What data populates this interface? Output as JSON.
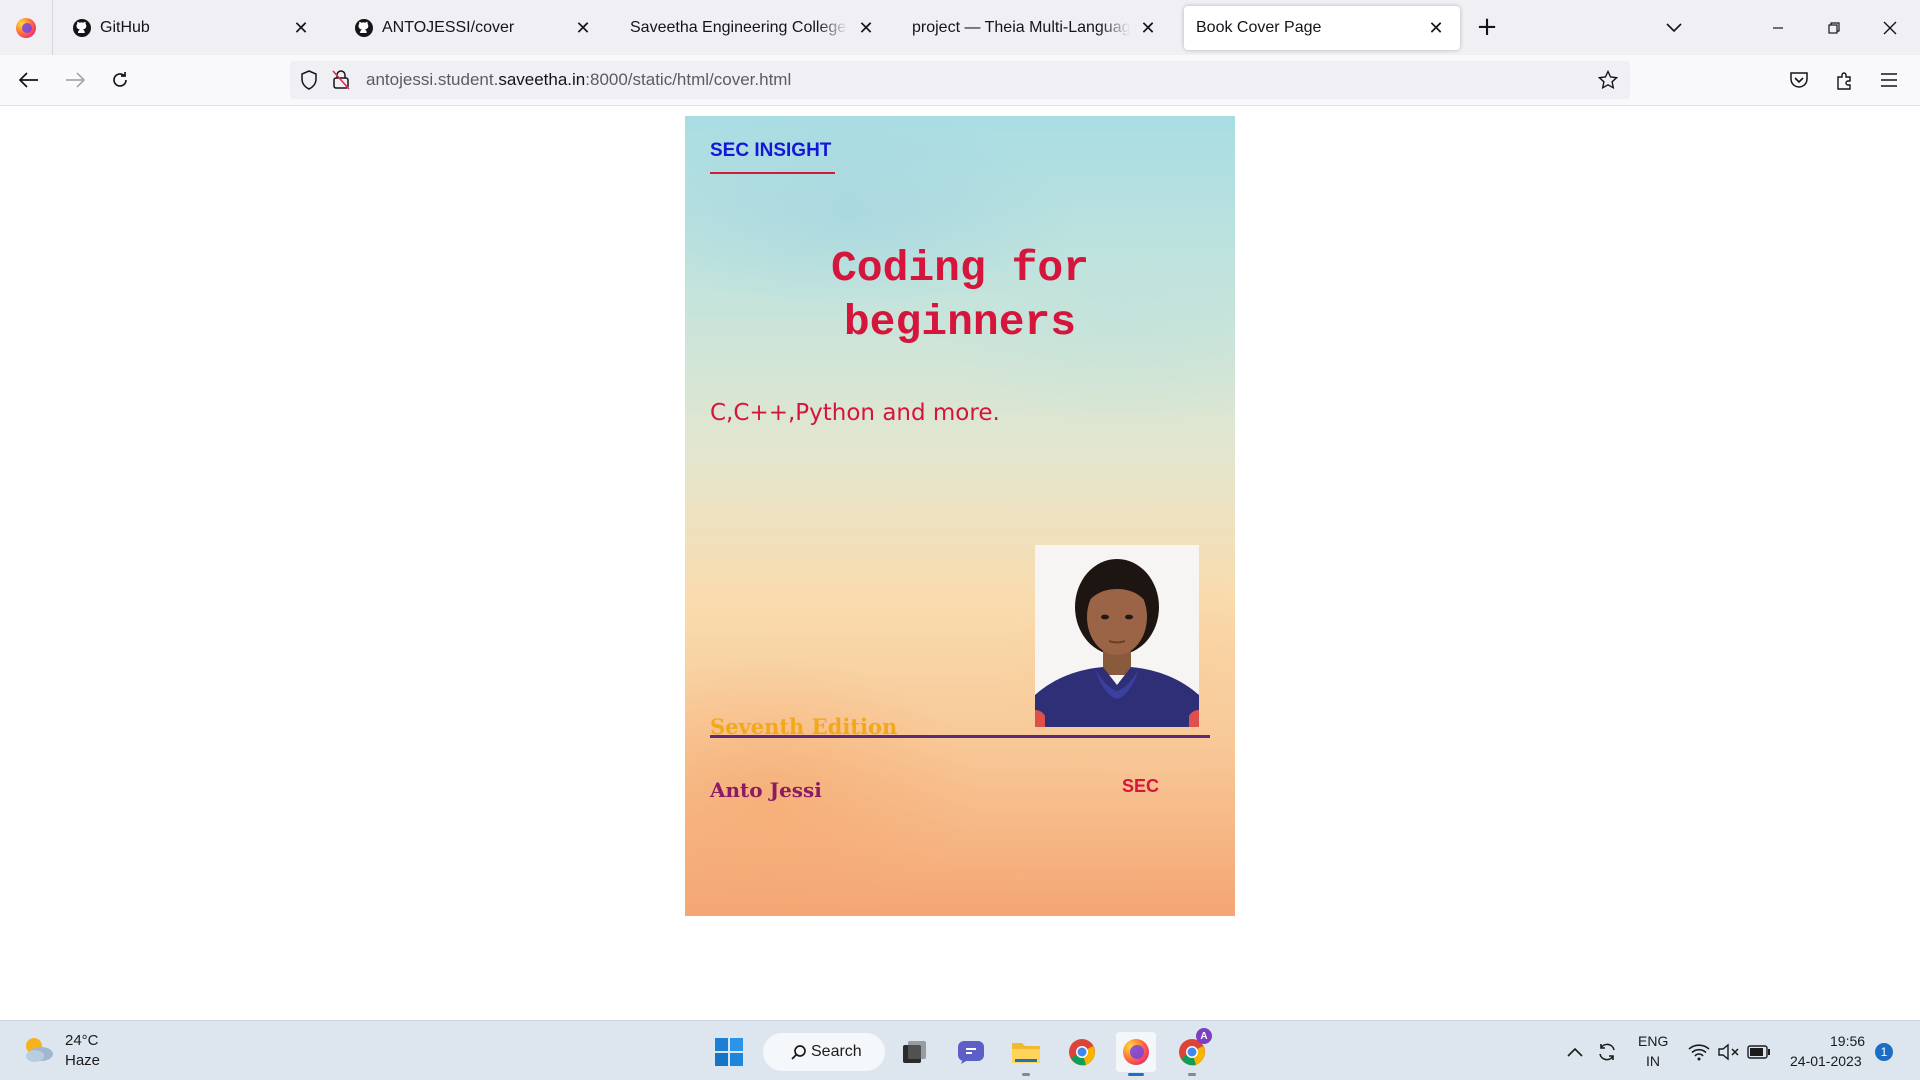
{
  "browser": {
    "tabs": [
      {
        "title": "GitHub",
        "icon": "github-icon",
        "active": false
      },
      {
        "title": "ANTOJESSI/cover",
        "icon": "github-icon",
        "active": false
      },
      {
        "title": "Saveetha Engineering College",
        "icon": "none",
        "active": false
      },
      {
        "title": "project — Theia Multi-Language Ex",
        "icon": "none",
        "active": false
      },
      {
        "title": "Book Cover Page",
        "icon": "none",
        "active": true
      }
    ],
    "new_tab_symbol": "+",
    "url": {
      "prefix": "antojessi.student.",
      "host": "saveetha.in",
      "suffix": ":8000/static/html/cover.html"
    }
  },
  "cover": {
    "brand": "SEC INSIGHT",
    "title_line1": "Coding for",
    "title_line2": "beginners",
    "subtitle": "C,C++,Python and more.",
    "edition": "Seventh Edition",
    "author": "Anto Jessi",
    "publisher": "SEC",
    "colors": {
      "brand": "#1418d6",
      "title": "#d5153c",
      "edition": "#f2a81a",
      "author": "#8a1c63",
      "divider": "#5b2a78"
    }
  },
  "taskbar": {
    "weather_temp": "24°C",
    "weather_condition": "Haze",
    "search_label": "Search",
    "language_line1": "ENG",
    "language_line2": "IN",
    "time": "19:56",
    "date": "24-01-2023",
    "notification_count": "1",
    "chrome_profile_badge": "A"
  }
}
